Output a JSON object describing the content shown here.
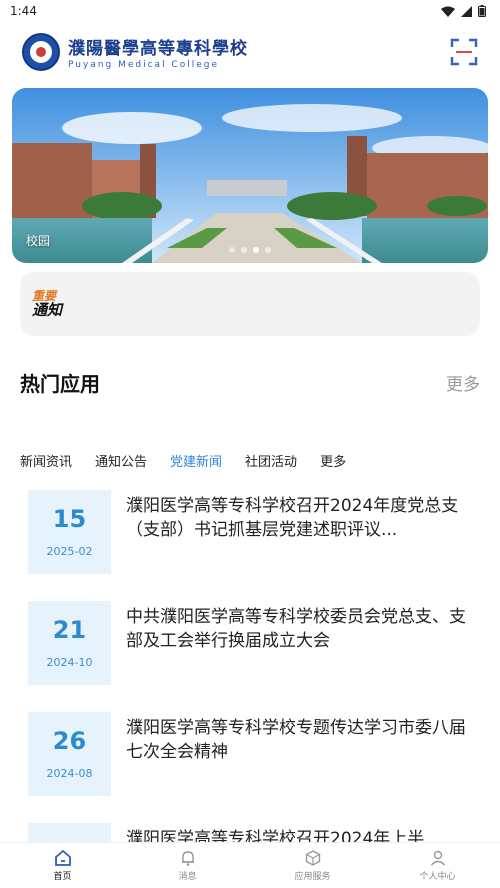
{
  "status_bar": {
    "time": "1:44"
  },
  "header": {
    "logo_cn": "濮陽醫學高等專科學校",
    "logo_en": "Puyang Medical College",
    "scan_icon": "scan-icon"
  },
  "banner": {
    "caption": "校园",
    "dot_count": 4,
    "active_dot": 2
  },
  "notice": {
    "badge_top": "重要",
    "badge_bottom": "通知"
  },
  "hot_apps": {
    "title": "热门应用",
    "more_label": "更多"
  },
  "tabs": [
    {
      "label": "新闻资讯",
      "active": false
    },
    {
      "label": "通知公告",
      "active": false
    },
    {
      "label": "党建新闻",
      "active": true
    },
    {
      "label": "社团活动",
      "active": false
    },
    {
      "label": "更多",
      "active": false
    }
  ],
  "news": [
    {
      "day": "15",
      "ym": "2025-02",
      "title": "濮阳医学高等专科学校召开2024年度党总支（支部）书记抓基层党建述职评议..."
    },
    {
      "day": "21",
      "ym": "2024-10",
      "title": "中共濮阳医学高等专科学校委员会党总支、支部及工会举行换届成立大会"
    },
    {
      "day": "26",
      "ym": "2024-08",
      "title": "濮阳医学高等专科学校专题传达学习市委八届七次全会精神"
    },
    {
      "day": "",
      "ym": "",
      "title": "濮阳医学高等专科学校召开2024年上半"
    }
  ],
  "bottom_nav": [
    {
      "label": "首页",
      "icon": "home-icon",
      "active": true
    },
    {
      "label": "消息",
      "icon": "bell-icon",
      "active": false
    },
    {
      "label": "应用服务",
      "icon": "apps-icon",
      "active": false
    },
    {
      "label": "个人中心",
      "icon": "user-icon",
      "active": false
    }
  ],
  "colors": {
    "accent": "#2e86d6",
    "date_bg": "#e7f3fc",
    "brand": "#1d3f8f"
  }
}
